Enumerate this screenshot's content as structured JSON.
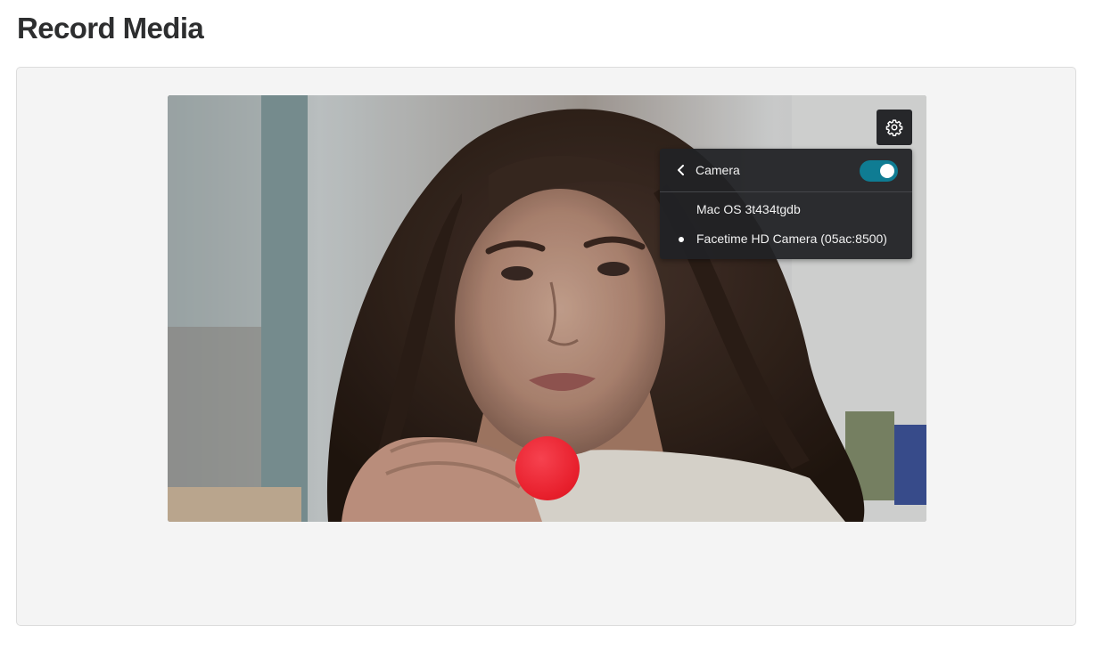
{
  "page": {
    "title": "Record Media"
  },
  "camera_settings": {
    "gear_icon": "gear-icon",
    "back_icon": "chevron-left-icon",
    "menu_title": "Camera",
    "camera_enabled": true,
    "toggle_color": "#0f7c93",
    "devices": [
      {
        "label": "Mac OS 3t434tgdb",
        "selected": false
      },
      {
        "label": "Facetime HD Camera (05ac:8500)",
        "selected": true
      }
    ]
  },
  "recorder": {
    "record_button_color": "#e8202d",
    "preview": "webcam-preview-image"
  }
}
